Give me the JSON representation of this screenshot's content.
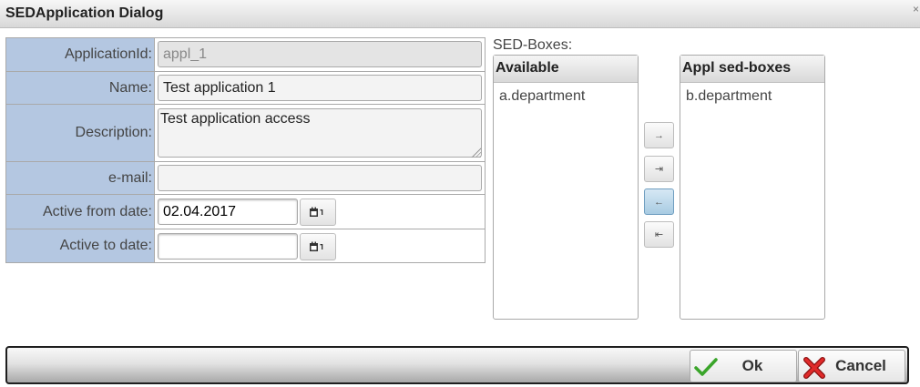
{
  "dialog": {
    "title": "SEDApplication Dialog"
  },
  "form": {
    "application_id": {
      "label": "ApplicationId:",
      "value": "appl_1"
    },
    "name": {
      "label": "Name:",
      "value": "Test application 1"
    },
    "description": {
      "label": "Description:",
      "value": "Test application access"
    },
    "email": {
      "label": "e-mail:",
      "value": ""
    },
    "active_from": {
      "label": "Active from date:",
      "value": "02.04.2017"
    },
    "active_to": {
      "label": "Active to date:",
      "value": ""
    }
  },
  "sed_boxes": {
    "label": "SED-Boxes:",
    "available": {
      "header": "Available",
      "items": [
        "a.department"
      ]
    },
    "assigned": {
      "header": "Appl sed-boxes",
      "items": [
        "b.department"
      ]
    },
    "move_buttons": {
      "add": "→",
      "add_all": "⇥",
      "remove": "←",
      "remove_all": "⇤"
    }
  },
  "footer": {
    "ok_label": "Ok",
    "cancel_label": "Cancel"
  },
  "colors": {
    "label_bg": "#b4c7e1",
    "active_move": "#a8cbe2",
    "ok_check": "#3aa52a",
    "cancel_x": "#d42323"
  }
}
